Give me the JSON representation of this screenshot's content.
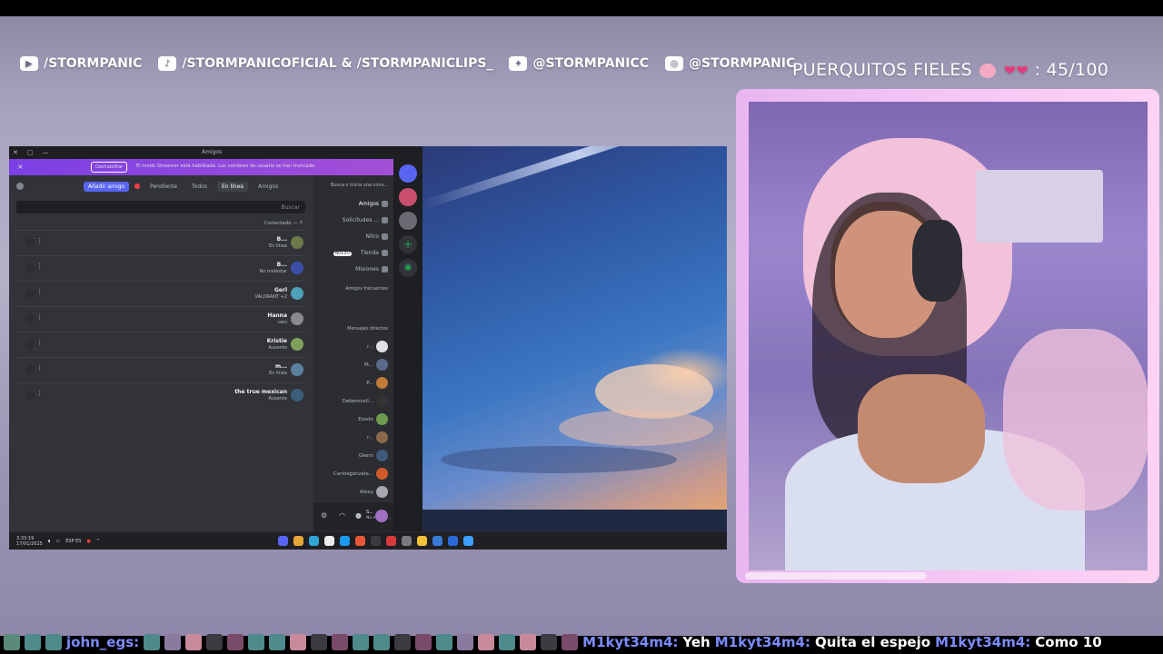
{
  "socials": {
    "youtube": "/STORMPANIC",
    "tiktok": "/STORMPANICOFICIAL & /STORMPANICLIPS_",
    "twitter": "@STORMPANICC",
    "instagram": "@STORMPANIC"
  },
  "counter": {
    "label": "PUERQUITOS FIELES",
    "value": ": 45/100",
    "progress_fraction": 0.45
  },
  "discord": {
    "window_title": "Amigos",
    "banner": {
      "dismiss_label": "×",
      "disable_button": "Deshabilitar",
      "message": "El modo Streamer está habilitado. Los nombres de usuario se han truncado."
    },
    "tabs": {
      "friends": "Amigos",
      "online": "En línea",
      "all": "Todos",
      "pending": "Pendiente",
      "add_friend": "Añadir amigo"
    },
    "search_placeholder": "Buscar",
    "online_header": "Conectado — 7",
    "friends": [
      {
        "name": "B...",
        "status": "En línea"
      },
      {
        "name": "B...",
        "status": "No molestar"
      },
      {
        "name": "Gerl",
        "status": "VALORANT +2"
      },
      {
        "name": "Hanna",
        "status": "uwu"
      },
      {
        "name": "Kristie",
        "status": "Ausente"
      },
      {
        "name": "m...",
        "status": "En línea"
      },
      {
        "name": "the true mexican",
        "status": "Ausente"
      }
    ],
    "channels": {
      "search": "Busca o inicia una conv...",
      "friends": "Amigos",
      "requests": "Solicitudes ...",
      "nitro": "Nitro",
      "shop": "Tienda",
      "shop_badge": "NUEVO",
      "missions": "Misiones",
      "frequent_header": "Amigos frecuentes",
      "dm_header": "Mensajes directos"
    },
    "dms": [
      "r...",
      "M...",
      "P...",
      "Debemosll...",
      "Exodo",
      "r...",
      "Glenn",
      "Carlosgonzale...",
      "Alexy"
    ],
    "user": {
      "name": "S...",
      "status": "No molest..."
    }
  },
  "taskbar": {
    "time": "3:33:19",
    "date": "17/01/2025",
    "lang": "ESP ES"
  },
  "chat": [
    {
      "user": "john_egs:",
      "message": ""
    },
    {
      "user": "M1kyt34m4:",
      "message": "Yeh"
    },
    {
      "user": "M1kyt34m4:",
      "message": "Quita el espejo"
    },
    {
      "user": "M1kyt34m4:",
      "message": "Como 10"
    }
  ],
  "colors": {
    "frame_pink": "#f3c4f4",
    "discord_blurple": "#5865f2",
    "chat_username": "#7c8cff"
  }
}
